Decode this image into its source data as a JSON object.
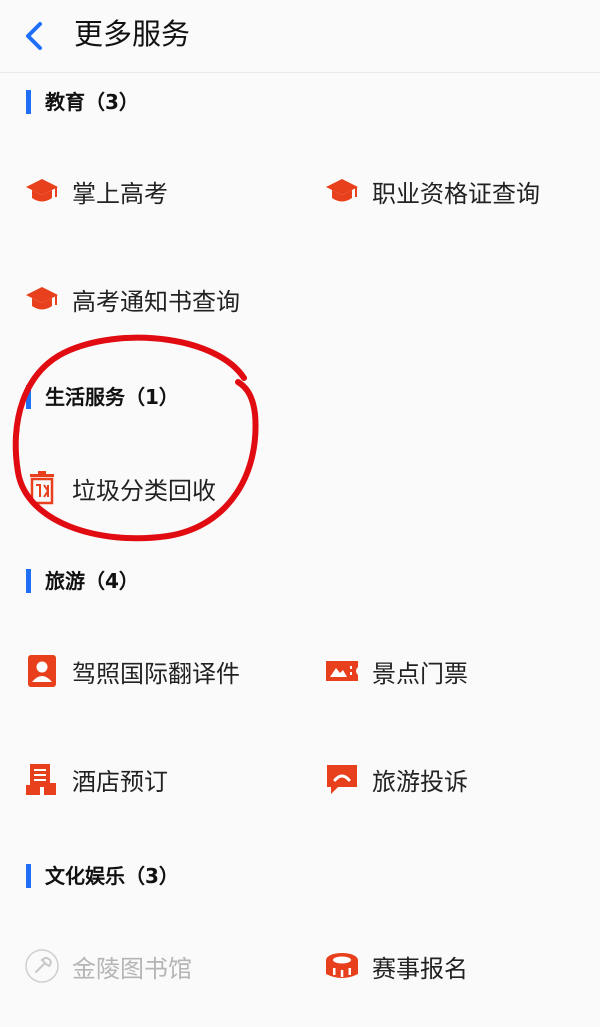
{
  "header": {
    "title": "更多服务",
    "back_icon": "chevron-left-icon"
  },
  "colors": {
    "accent": "#1f6ef6",
    "icon_red": "#e8401c",
    "annotation_red": "#e10c12"
  },
  "sections": [
    {
      "title": "教育（3）",
      "items": [
        {
          "label": "掌上高考",
          "icon": "graduation-cap-icon"
        },
        {
          "label": "职业资格证查询",
          "icon": "graduation-cap-icon"
        },
        {
          "label": "高考通知书查询",
          "icon": "graduation-cap-icon"
        }
      ]
    },
    {
      "title": "生活服务（1）",
      "items": [
        {
          "label": "垃圾分类回收",
          "icon": "recycle-bin-icon"
        }
      ]
    },
    {
      "title": "旅游（4）",
      "items": [
        {
          "label": "驾照国际翻译件",
          "icon": "id-card-icon"
        },
        {
          "label": "景点门票",
          "icon": "ticket-icon"
        },
        {
          "label": "酒店预订",
          "icon": "hotel-icon"
        },
        {
          "label": "旅游投诉",
          "icon": "complaint-icon"
        }
      ]
    },
    {
      "title": "文化娱乐（3）",
      "items": [
        {
          "label": "金陵图书馆",
          "icon": "library-icon",
          "disabled": true
        },
        {
          "label": "赛事报名",
          "icon": "stadium-icon"
        }
      ]
    }
  ]
}
